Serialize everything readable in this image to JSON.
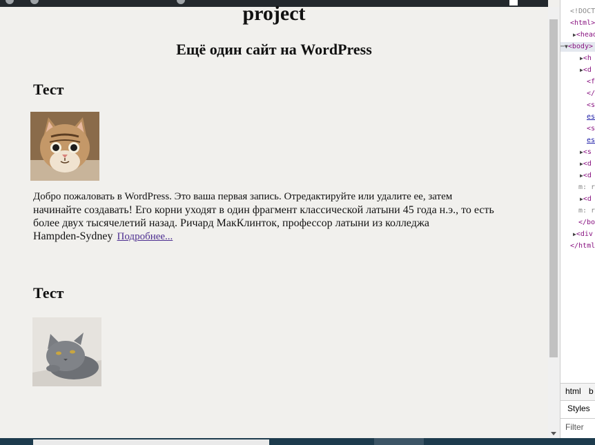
{
  "site": {
    "title": "project",
    "tagline": "Ещё один сайт на WordPress"
  },
  "posts": [
    {
      "title": "Тест",
      "thumbnail_icon": "kitten-photo",
      "excerpt_lines": [
        "Добро пожаловать в WordPress. Это ваша первая запись. Отредактируйте или удалите ее, затем",
        "начинайте создавать!  Его корни уходят в один фрагмент классической латыни 45 года н.э., то есть",
        "более двух тысячелетий назад. Ричард МакКлинток, профессор латыни из колледжа",
        "Hampden-Sydney"
      ],
      "read_more": "Подробнее..."
    },
    {
      "title": "Тест",
      "thumbnail_icon": "gray-cat-photo"
    }
  ],
  "devtools": {
    "lines": [
      "<!DOCTYPE html>",
      "<html>",
      "<head>",
      "<body>",
      "<h",
      "<d",
      "<f",
      "</",
      "<s",
      "es",
      "<s",
      "es",
      "<s",
      "<d",
      "<d",
      "m: r",
      "<d",
      "m: r",
      "</bo",
      "<div",
      "</html>"
    ],
    "tabs": [
      "html",
      "b"
    ],
    "styles_label": "Styles",
    "filter_label": "Filter"
  },
  "colors": {
    "page_bg": "#f1f0ed",
    "link": "#4b2c8f",
    "admin_bar": "#23282d",
    "taskbar": "#1d3b4d"
  }
}
